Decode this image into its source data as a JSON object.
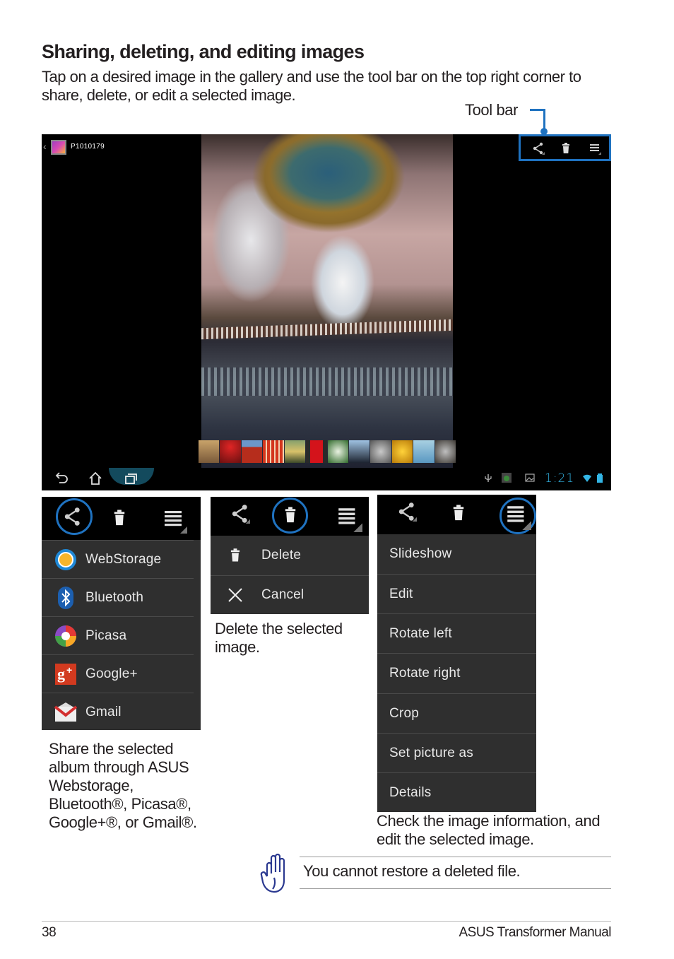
{
  "heading": "Sharing, deleting, and editing images",
  "intro": "Tap on a desired image in the gallery and use the tool bar on the top right corner to share, delete, or edit a selected image.",
  "toolbar_label": "Tool bar",
  "screen": {
    "photo_title": "P1010179",
    "back_glyph": "‹",
    "toolbar_icons": [
      "share-icon",
      "trash-icon",
      "overflow-menu-icon"
    ],
    "filmstrip_count": 12,
    "nav_buttons": [
      "back-icon",
      "home-icon",
      "recent-apps-icon"
    ],
    "status_time": "1:21",
    "status_icons": [
      "usb-icon",
      "app-notification-icon",
      "gallery-notification-icon",
      "wifi-icon",
      "battery-icon"
    ],
    "accent_color": "#33b5e5"
  },
  "share_panel": {
    "items": [
      {
        "label": "WebStorage",
        "icon": "webstorage-icon"
      },
      {
        "label": "Bluetooth",
        "icon": "bluetooth-icon"
      },
      {
        "label": "Picasa",
        "icon": "picasa-icon"
      },
      {
        "label": "Google+",
        "icon": "google-plus-icon"
      },
      {
        "label": "Gmail",
        "icon": "gmail-icon"
      }
    ],
    "caption": "Share the selected album through ASUS Webstorage, Bluetooth®, Picasa®, Google+®, or Gmail®."
  },
  "delete_panel": {
    "items": [
      {
        "label": "Delete",
        "icon": "trash-icon"
      },
      {
        "label": "Cancel",
        "icon": "close-icon"
      }
    ],
    "caption": "Delete the selected image."
  },
  "menu_panel": {
    "items": [
      {
        "label": "Slideshow"
      },
      {
        "label": "Edit"
      },
      {
        "label": "Rotate left"
      },
      {
        "label": "Rotate right"
      },
      {
        "label": "Crop"
      },
      {
        "label": "Set picture as"
      },
      {
        "label": "Details"
      }
    ],
    "caption": "Check the image information, and edit the selected image."
  },
  "note": "You cannot restore a deleted file.",
  "footer": {
    "page_number": "38",
    "manual_title": "ASUS Transformer Manual"
  },
  "colors": {
    "highlight": "#1f72c0",
    "panel_bg": "#2f2f2f",
    "note_icon": "#2b3990"
  }
}
